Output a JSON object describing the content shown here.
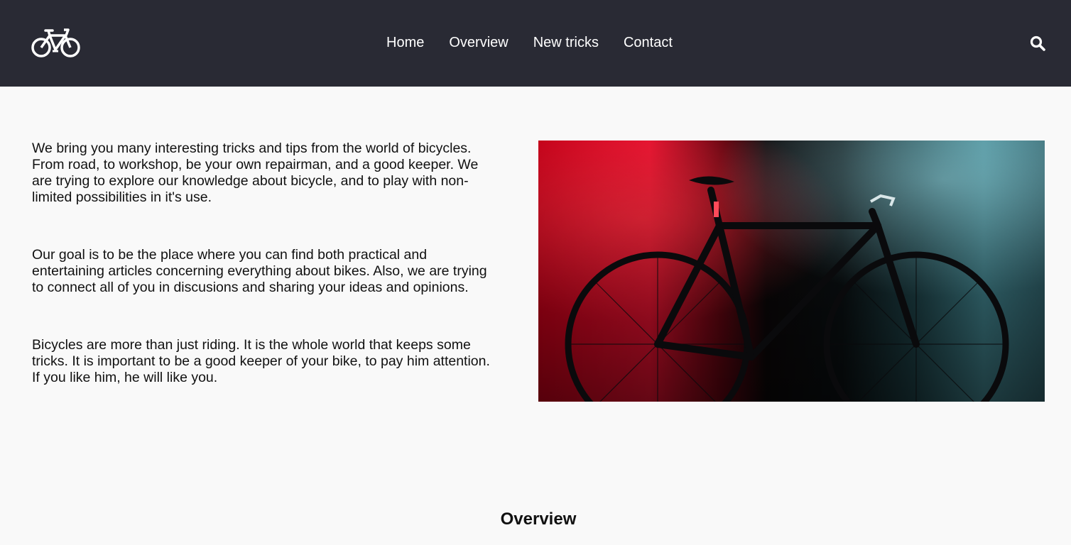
{
  "header": {
    "logo_icon": "bicycle-icon",
    "nav": [
      {
        "label": "Home"
      },
      {
        "label": "Overview"
      },
      {
        "label": "New tricks"
      },
      {
        "label": "Contact"
      }
    ],
    "search_icon": "search-icon"
  },
  "intro": {
    "paragraphs": [
      "We bring you many interesting tricks and tips from the world of bicycles. From road, to workshop, be your own repairman, and a good keeper. We are trying to explore our knowledge about bicycle, and to play with non-limited possibilities in it's use.",
      "Our goal is to be the place where you can find both practical and entertaining articles concerning everything about bikes. Also, we are trying to connect all of you in discusions and sharing your ideas and opinions.",
      "Bicycles are more than just riding. It is the whole world that keeps some tricks. It is important to be a good keeper of your bike, to pay him attention. If you like him, he will like you."
    ]
  },
  "section": {
    "title": "Overview"
  },
  "colors": {
    "navbar": "#292a34",
    "background": "#f9f9f9",
    "nav_text": "#ffffff",
    "body_text": "#111111"
  }
}
